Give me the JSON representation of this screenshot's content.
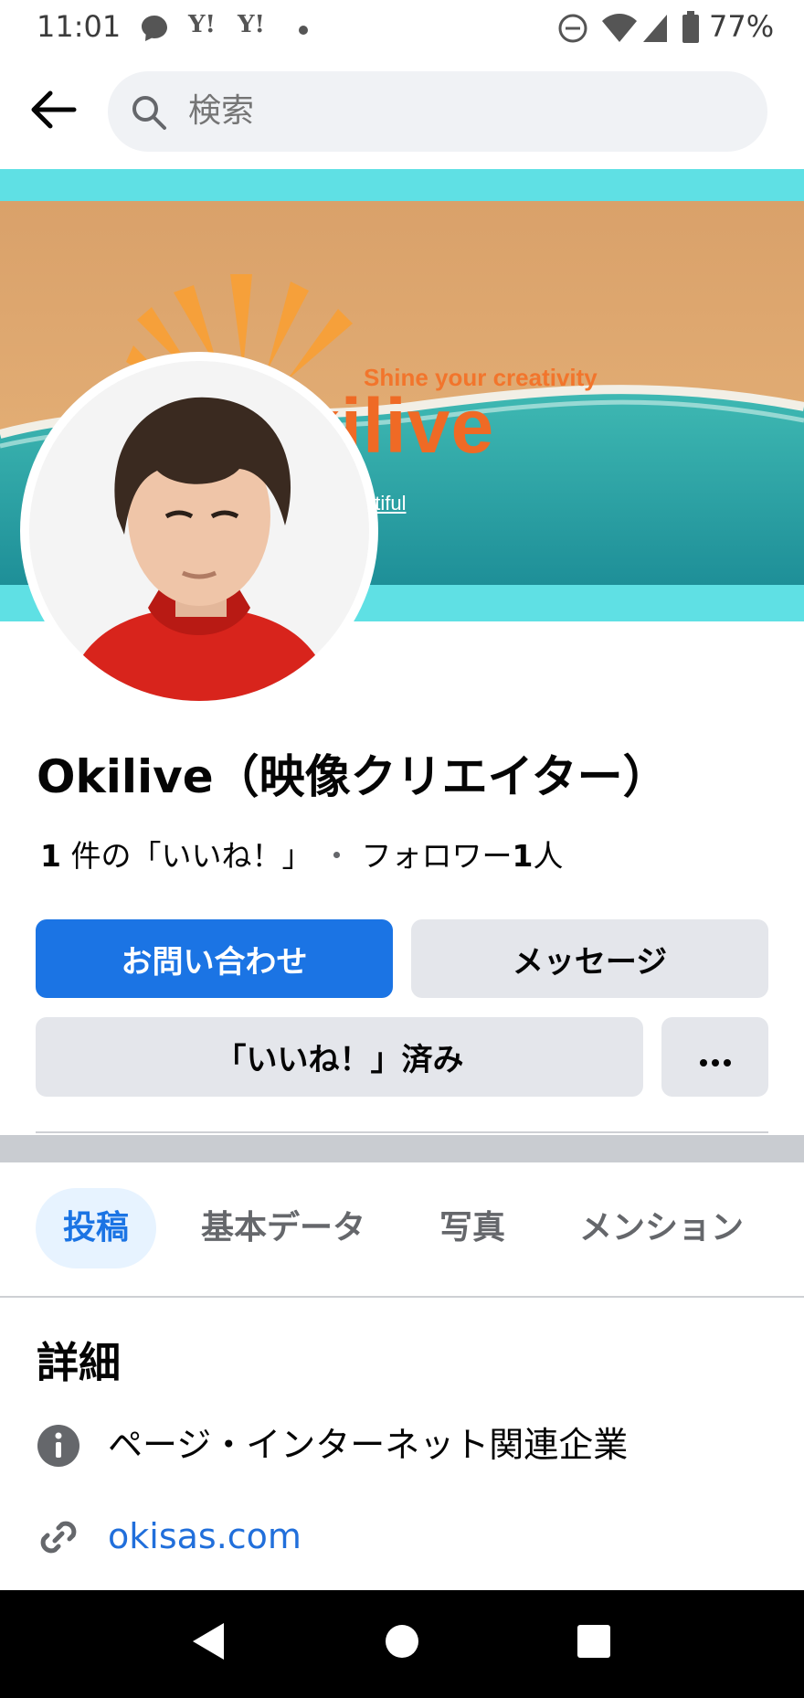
{
  "status_bar": {
    "time": "11:01",
    "yahoo_1": "Y!",
    "yahoo_2": "Y!",
    "battery": "77%",
    "icons": [
      "chat-bubble-icon",
      "yahoo-icon",
      "yahoo-icon",
      "dot-icon",
      "do-not-disturb-icon",
      "wifi-icon",
      "cell-signal-icon",
      "battery-icon"
    ]
  },
  "header": {
    "search_placeholder": "検索",
    "back_icon": "arrow-left-icon",
    "search_icon": "magnifier-icon"
  },
  "cover": {
    "tagline": "Shine your creativity",
    "brand": "kilive",
    "small_text": "utiful"
  },
  "profile": {
    "name": "Okilive（映像クリエイター）",
    "likes_count": "1",
    "likes_label": "件の「いいね！」",
    "separator": "・",
    "followers_label": "フォロワー",
    "followers_count": "1",
    "followers_unit": "人"
  },
  "actions": {
    "contact": "お問い合わせ",
    "message": "メッセージ",
    "liked": "「いいね！」済み",
    "more": "•••"
  },
  "tabs": [
    "投稿",
    "基本データ",
    "写真",
    "メンション"
  ],
  "details": {
    "title": "詳細",
    "category": "ページ・インターネット関連企業",
    "website": "okisas.com"
  },
  "colors": {
    "primary_blue": "#1b74e4",
    "secondary_gray": "#e4e6eb",
    "link_blue": "#216fdb",
    "cover_band": "#5fe0e4"
  }
}
